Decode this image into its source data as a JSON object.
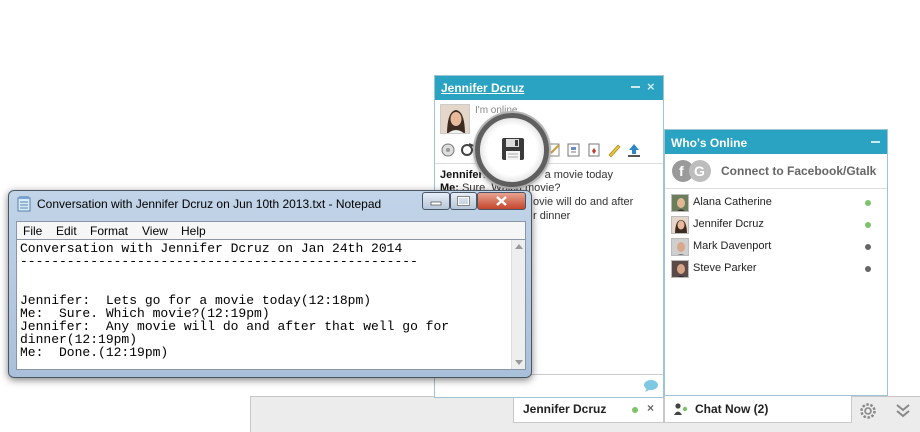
{
  "chat_window": {
    "title": "Jennifer Dcruz",
    "status": "I'm online",
    "messages": [
      {
        "sender": "Jennifer:",
        "text": "Lets go for a movie today"
      },
      {
        "sender": "Me:",
        "text": "Sure. Which movie?"
      },
      {
        "sender": "",
        "text": "ovie will do and after"
      },
      {
        "sender": "",
        "text": "r dinner"
      }
    ]
  },
  "whos_online": {
    "title": "Who's Online",
    "connect_label": "Connect to Facebook/Gtalk",
    "contacts": [
      {
        "name": "Alana Catherine",
        "status": "online",
        "color": "#7cc36a"
      },
      {
        "name": "Jennifer Dcruz",
        "status": "online",
        "color": "#7cc36a"
      },
      {
        "name": "Mark Davenport",
        "status": "offline",
        "color": "#666666"
      },
      {
        "name": "Steve Parker",
        "status": "offline",
        "color": "#666666"
      }
    ]
  },
  "chat_bar": {
    "open_chat_name": "Jennifer Dcruz",
    "chat_now_label": "Chat Now (2)"
  },
  "notepad": {
    "title": "Conversation with Jennifer Dcruz on Jun 10th 2013.txt - Notepad",
    "menu": [
      "File",
      "Edit",
      "Format",
      "View",
      "Help"
    ],
    "lines": [
      "Conversation with Jennifer Dcruz on Jan 24th 2014",
      "---------------------------------------------------",
      "",
      "",
      "Jennifer:  Lets go for a movie today(12:18pm)",
      "Me:  Sure. Which movie?(12:19pm)",
      "Jennifer:  Any movie will do and after that well go for",
      "dinner(12:19pm)",
      "Me:  Done.(12:19pm)"
    ]
  },
  "colors": {
    "accent": "#2aa2c2",
    "online": "#7cc36a"
  }
}
